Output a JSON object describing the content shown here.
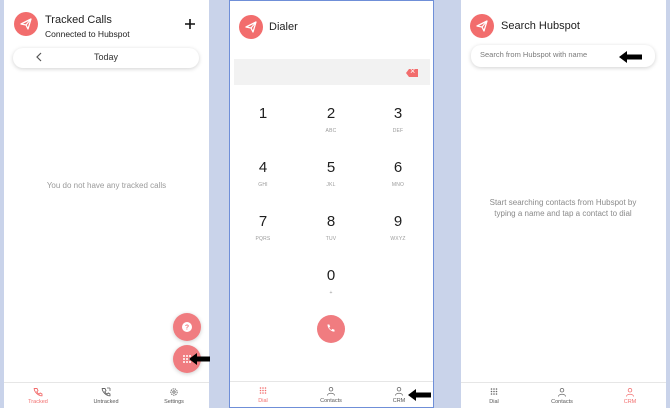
{
  "tracked": {
    "title": "Tracked Calls",
    "subtitle": "Connected to Hubspot",
    "add_icon": "plus-icon",
    "date_label": "Today",
    "empty_text": "You do not have any tracked calls",
    "fab_help_icon": "help-icon",
    "fab_dialpad_icon": "dialpad-icon",
    "tabs": [
      {
        "label": "Tracked",
        "icon": "phone-icon"
      },
      {
        "label": "Untracked",
        "icon": "phone-incoming-icon"
      },
      {
        "label": "Settings",
        "icon": "gear-icon"
      }
    ]
  },
  "dialer": {
    "title": "Dialer",
    "keys": [
      {
        "digit": "1",
        "letters": ""
      },
      {
        "digit": "2",
        "letters": "ABC"
      },
      {
        "digit": "3",
        "letters": "DEF"
      },
      {
        "digit": "4",
        "letters": "GHI"
      },
      {
        "digit": "5",
        "letters": "JKL"
      },
      {
        "digit": "6",
        "letters": "MNO"
      },
      {
        "digit": "7",
        "letters": "PQRS"
      },
      {
        "digit": "8",
        "letters": "TUV"
      },
      {
        "digit": "9",
        "letters": "WXYZ"
      },
      {
        "digit": "0",
        "letters": "+"
      }
    ],
    "tabs": [
      {
        "label": "Dial",
        "icon": "dialpad-icon"
      },
      {
        "label": "Contacts",
        "icon": "person-icon"
      },
      {
        "label": "CRM",
        "icon": "crm-icon"
      }
    ]
  },
  "search": {
    "title": "Search Hubspot",
    "placeholder": "Search from Hubspot with name",
    "empty_text": "Start searching contacts from Hubspot by typing a name and tap a contact to dial",
    "tabs": [
      {
        "label": "Dial",
        "icon": "dialpad-icon"
      },
      {
        "label": "Contacts",
        "icon": "person-icon"
      },
      {
        "label": "CRM",
        "icon": "crm-icon"
      }
    ]
  },
  "colors": {
    "accent": "#f26d6d",
    "fab": "#f07c80",
    "background": "#c9d3ea",
    "dialer_border": "#6f8fd8"
  }
}
